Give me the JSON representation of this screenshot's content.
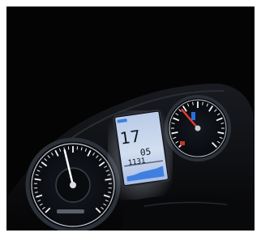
{
  "photo": {
    "subject": "motorcycle-instrument-cluster",
    "lighting": "night",
    "colors": {
      "background": "#040405",
      "dial_face": "#0b0c10",
      "dial_ring": "#2c3038",
      "tick": "#f2f5f8",
      "needle_left": "#ffffff",
      "needle_right": "#e63a2e",
      "lcd_glow": "#c8d9f2",
      "lcd_bar": "#3f7fe0",
      "accent_blue": "#2b6fe0"
    }
  },
  "lcd": {
    "main_readout": "17",
    "secondary_readout": "05",
    "small_readout": "1131"
  },
  "dials": {
    "left": {
      "kind": "speedometer",
      "needle_level": 0.45
    },
    "right": {
      "kind": "tachometer",
      "needle_level": 0.35
    }
  }
}
